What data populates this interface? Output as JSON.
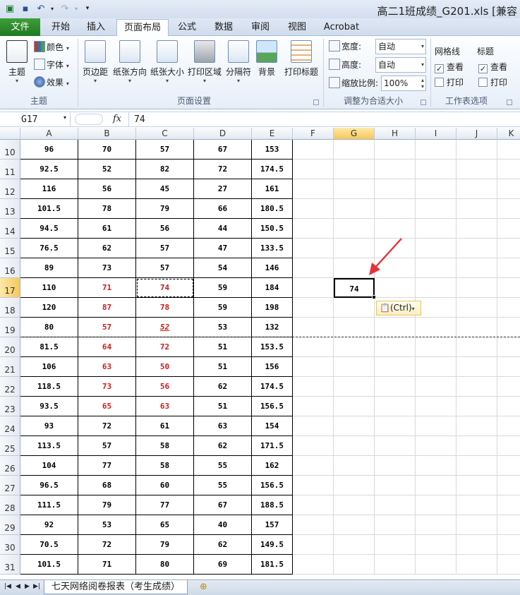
{
  "title_bar": {
    "title": "高二1班成绩_G201.xls [兼容"
  },
  "tabs": [
    {
      "label": "文件",
      "active": false,
      "file": true
    },
    {
      "label": "开始",
      "active": false
    },
    {
      "label": "插入",
      "active": false
    },
    {
      "label": "页面布局",
      "active": true
    },
    {
      "label": "公式",
      "active": false
    },
    {
      "label": "数据",
      "active": false
    },
    {
      "label": "审阅",
      "active": false
    },
    {
      "label": "视图",
      "active": false
    },
    {
      "label": "Acrobat",
      "active": false
    }
  ],
  "ribbon": {
    "theme_group": {
      "label": "主题",
      "theme_button": "主题",
      "colors": "颜色",
      "fonts": "字体",
      "effects": "效果"
    },
    "page_setup_group": {
      "label": "页面设置",
      "margins": "页边距",
      "orientation": "纸张方向",
      "size": "纸张大小",
      "print_area": "打印区域",
      "breaks": "分隔符",
      "background": "背景",
      "print_titles": "打印标题"
    },
    "scale_group": {
      "label": "调整为合适大小",
      "width_label": "宽度:",
      "width_value": "自动",
      "height_label": "高度:",
      "height_value": "自动",
      "scale_label": "缩放比例:",
      "scale_value": "100%"
    },
    "sheet_options_group": {
      "label": "工作表选项",
      "gridlines": "网格线",
      "headings": "标题",
      "view": "查看",
      "print": "打印"
    }
  },
  "formula_bar": {
    "name_box": "G17",
    "fx": "fx",
    "value": "74"
  },
  "columns": [
    "A",
    "B",
    "C",
    "D",
    "E",
    "F",
    "G",
    "H",
    "I",
    "J",
    "K"
  ],
  "selected_column": "G",
  "selected_row": "17",
  "rows": [
    {
      "num": "10",
      "cells": [
        "96",
        "70",
        "57",
        "67",
        "153"
      ],
      "red": [
        false,
        false,
        false,
        false,
        false
      ]
    },
    {
      "num": "11",
      "cells": [
        "92.5",
        "52",
        "82",
        "72",
        "174.5"
      ],
      "red": [
        false,
        false,
        false,
        false,
        false
      ]
    },
    {
      "num": "12",
      "cells": [
        "116",
        "56",
        "45",
        "27",
        "161"
      ],
      "red": [
        false,
        false,
        false,
        false,
        false
      ]
    },
    {
      "num": "13",
      "cells": [
        "101.5",
        "78",
        "79",
        "66",
        "180.5"
      ],
      "red": [
        false,
        false,
        false,
        false,
        false
      ]
    },
    {
      "num": "14",
      "cells": [
        "94.5",
        "61",
        "56",
        "44",
        "150.5"
      ],
      "red": [
        false,
        false,
        false,
        false,
        false
      ]
    },
    {
      "num": "15",
      "cells": [
        "76.5",
        "62",
        "57",
        "47",
        "133.5"
      ],
      "red": [
        false,
        false,
        false,
        false,
        false
      ]
    },
    {
      "num": "16",
      "cells": [
        "89",
        "73",
        "57",
        "54",
        "146"
      ],
      "red": [
        false,
        false,
        false,
        false,
        false
      ]
    },
    {
      "num": "17",
      "cells": [
        "110",
        "71",
        "74",
        "59",
        "184"
      ],
      "red": [
        false,
        true,
        true,
        false,
        false
      ]
    },
    {
      "num": "18",
      "cells": [
        "120",
        "87",
        "78",
        "59",
        "198"
      ],
      "red": [
        false,
        true,
        true,
        false,
        false
      ]
    },
    {
      "num": "19",
      "cells": [
        "80",
        "57",
        "52",
        "53",
        "132"
      ],
      "red": [
        false,
        true,
        true,
        false,
        false
      ]
    },
    {
      "num": "20",
      "cells": [
        "81.5",
        "64",
        "72",
        "51",
        "153.5"
      ],
      "red": [
        false,
        true,
        true,
        false,
        false
      ]
    },
    {
      "num": "21",
      "cells": [
        "106",
        "63",
        "50",
        "51",
        "156"
      ],
      "red": [
        false,
        true,
        true,
        false,
        false
      ]
    },
    {
      "num": "22",
      "cells": [
        "118.5",
        "73",
        "56",
        "62",
        "174.5"
      ],
      "red": [
        false,
        true,
        true,
        false,
        false
      ]
    },
    {
      "num": "23",
      "cells": [
        "93.5",
        "65",
        "63",
        "51",
        "156.5"
      ],
      "red": [
        false,
        true,
        true,
        false,
        false
      ]
    },
    {
      "num": "24",
      "cells": [
        "93",
        "72",
        "61",
        "63",
        "154"
      ],
      "red": [
        false,
        false,
        false,
        false,
        false
      ]
    },
    {
      "num": "25",
      "cells": [
        "113.5",
        "57",
        "58",
        "62",
        "171.5"
      ],
      "red": [
        false,
        false,
        false,
        false,
        false
      ]
    },
    {
      "num": "26",
      "cells": [
        "104",
        "77",
        "58",
        "55",
        "162"
      ],
      "red": [
        false,
        false,
        false,
        false,
        false
      ]
    },
    {
      "num": "27",
      "cells": [
        "96.5",
        "68",
        "60",
        "55",
        "156.5"
      ],
      "red": [
        false,
        false,
        false,
        false,
        false
      ]
    },
    {
      "num": "28",
      "cells": [
        "111.5",
        "79",
        "77",
        "67",
        "188.5"
      ],
      "red": [
        false,
        false,
        false,
        false,
        false
      ]
    },
    {
      "num": "29",
      "cells": [
        "92",
        "53",
        "65",
        "40",
        "157"
      ],
      "red": [
        false,
        false,
        false,
        false,
        false
      ]
    },
    {
      "num": "30",
      "cells": [
        "70.5",
        "72",
        "79",
        "62",
        "149.5"
      ],
      "red": [
        false,
        false,
        false,
        false,
        false
      ]
    },
    {
      "num": "31",
      "cells": [
        "101.5",
        "71",
        "80",
        "69",
        "181.5"
      ],
      "red": [
        false,
        false,
        false,
        false,
        false
      ]
    }
  ],
  "pasted_cell": {
    "column": "G",
    "row": "17",
    "value": "74"
  },
  "paste_options": "(Ctrl)",
  "sheet_tab": "七天网络阅卷报表（考生成绩）",
  "colors": {
    "red_text": "#d01a1a",
    "file_tab": "#2a8a2e",
    "arrow": "#e8303a"
  }
}
